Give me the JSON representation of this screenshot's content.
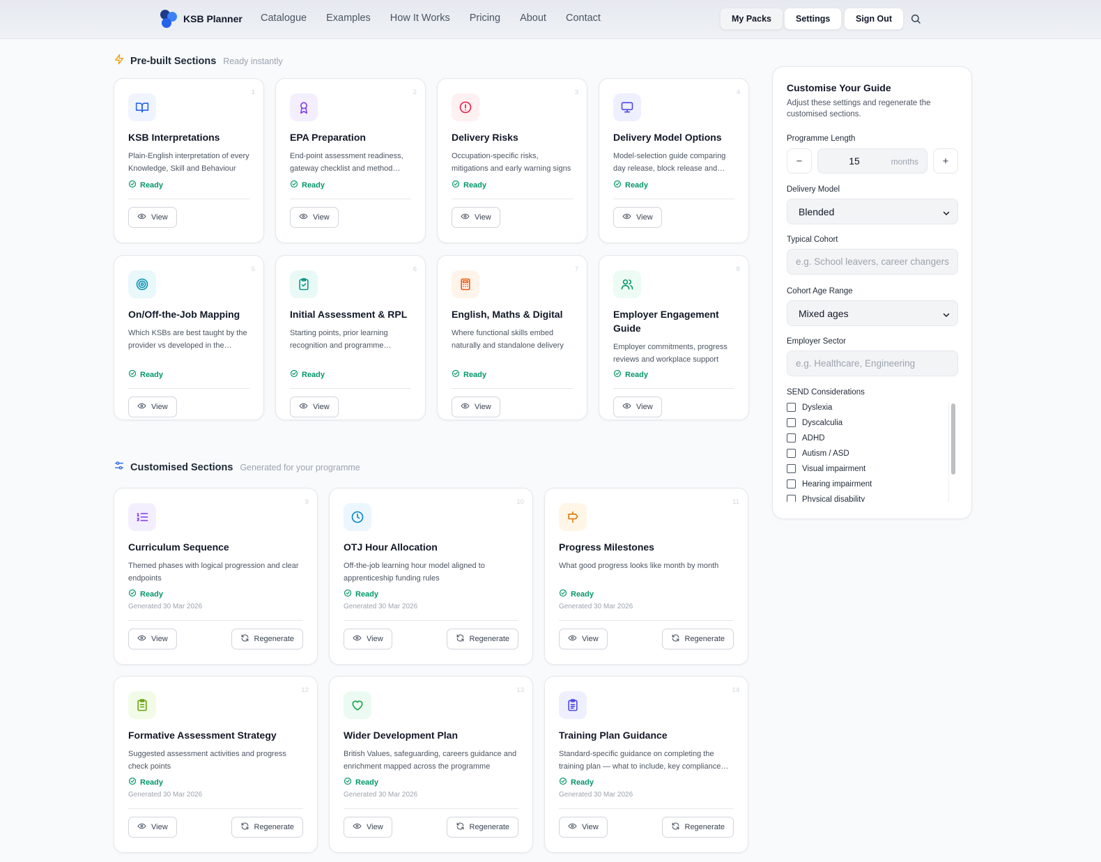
{
  "brand": {
    "name": "KSB Planner"
  },
  "nav": {
    "links": [
      "Catalogue",
      "Examples",
      "How It Works",
      "Pricing",
      "About",
      "Contact"
    ],
    "buttons": {
      "my_packs": "My Packs",
      "settings": "Settings",
      "sign_out": "Sign Out"
    },
    "search_icon": "search-icon"
  },
  "prebuilt": {
    "title": "Pre-built Sections",
    "subtitle": "Ready instantly",
    "cards": [
      {
        "num": "1",
        "icon": "book-open-icon",
        "title": "KSB Interpretations",
        "desc": "Plain-English interpretation of every Knowledge, Skill and Behaviour",
        "status": "Ready",
        "view": "View"
      },
      {
        "num": "2",
        "icon": "award-icon",
        "title": "EPA Preparation",
        "desc": "End-point assessment readiness, gateway checklist and method guidance",
        "status": "Ready",
        "view": "View"
      },
      {
        "num": "3",
        "icon": "alert-circle-icon",
        "title": "Delivery Risks",
        "desc": "Occupation-specific risks, mitigations and early warning signs",
        "status": "Ready",
        "view": "View"
      },
      {
        "num": "4",
        "icon": "monitor-icon",
        "title": "Delivery Model Options",
        "desc": "Model-selection guide comparing day release, block release and blended",
        "status": "Ready",
        "view": "View"
      },
      {
        "num": "5",
        "icon": "target-icon",
        "title": "On/Off-the-Job Mapping",
        "desc": "Which KSBs are best taught by the provider vs developed in the workplace",
        "status": "Ready",
        "view": "View"
      },
      {
        "num": "6",
        "icon": "clipboard-check-icon",
        "title": "Initial Assessment & RPL",
        "desc": "Starting points, prior learning recognition and programme adjustments",
        "status": "Ready",
        "view": "View"
      },
      {
        "num": "7",
        "icon": "calculator-icon",
        "title": "English, Maths & Digital",
        "desc": "Where functional skills embed naturally and standalone delivery",
        "status": "Ready",
        "view": "View"
      },
      {
        "num": "8",
        "icon": "users-icon",
        "title": "Employer Engagement Guide",
        "desc": "Employer commitments, progress reviews and workplace support",
        "status": "Ready",
        "view": "View"
      }
    ]
  },
  "customised": {
    "title": "Customised Sections",
    "subtitle": "Generated for your programme",
    "cards": [
      {
        "num": "9",
        "icon": "list-ordered-icon",
        "title": "Curriculum Sequence",
        "desc": "Themed phases with logical progression and clear endpoints",
        "status": "Ready",
        "generated": "Generated 30 Mar 2026",
        "view": "View",
        "regen": "Regenerate"
      },
      {
        "num": "10",
        "icon": "clock-icon",
        "title": "OTJ Hour Allocation",
        "desc": "Off-the-job learning hour model aligned to apprenticeship funding rules",
        "status": "Ready",
        "generated": "Generated 30 Mar 2026",
        "view": "View",
        "regen": "Regenerate"
      },
      {
        "num": "11",
        "icon": "signpost-icon",
        "title": "Progress Milestones",
        "desc": "What good progress looks like month by month",
        "status": "Ready",
        "generated": "Generated 30 Mar 2026",
        "view": "View",
        "regen": "Regenerate"
      },
      {
        "num": "12",
        "icon": "clipboard-list-icon",
        "title": "Formative Assessment Strategy",
        "desc": "Suggested assessment activities and progress check points",
        "status": "Ready",
        "generated": "Generated 30 Mar 2026",
        "view": "View",
        "regen": "Regenerate"
      },
      {
        "num": "13",
        "icon": "heart-icon",
        "title": "Wider Development Plan",
        "desc": "British Values, safeguarding, careers guidance and enrichment mapped across the programme",
        "status": "Ready",
        "generated": "Generated 30 Mar 2026",
        "view": "View",
        "regen": "Regenerate"
      },
      {
        "num": "14",
        "icon": "clipboard-text-icon",
        "title": "Training Plan Guidance",
        "desc": "Standard-specific guidance on completing the training plan — what to include, key compliance points",
        "status": "Ready",
        "generated": "Generated 30 Mar 2026",
        "view": "View",
        "regen": "Regenerate"
      }
    ]
  },
  "panel": {
    "title": "Customise Your Guide",
    "subtitle": "Adjust these settings and regenerate the customised sections.",
    "programme_length": {
      "label": "Programme Length",
      "value": "15",
      "unit": "months",
      "minus": "−",
      "plus": "+"
    },
    "delivery_model": {
      "label": "Delivery Model",
      "value": "Blended"
    },
    "typical_cohort": {
      "label": "Typical Cohort",
      "value": "",
      "placeholder": "e.g. School leavers, career changers"
    },
    "cohort_age_range": {
      "label": "Cohort Age Range",
      "value": "Mixed ages"
    },
    "employer_sector": {
      "label": "Employer Sector",
      "value": "",
      "placeholder": "e.g. Healthcare, Engineering"
    },
    "send": {
      "label": "SEND Considerations",
      "options": [
        "Dyslexia",
        "Dyscalculia",
        "ADHD",
        "Autism / ASD",
        "Visual impairment",
        "Hearing impairment",
        "Physical disability"
      ]
    }
  },
  "colors": {
    "ready_green": "#059669",
    "card_border": "#e5e7eb",
    "brand_blue": "#2563eb"
  }
}
